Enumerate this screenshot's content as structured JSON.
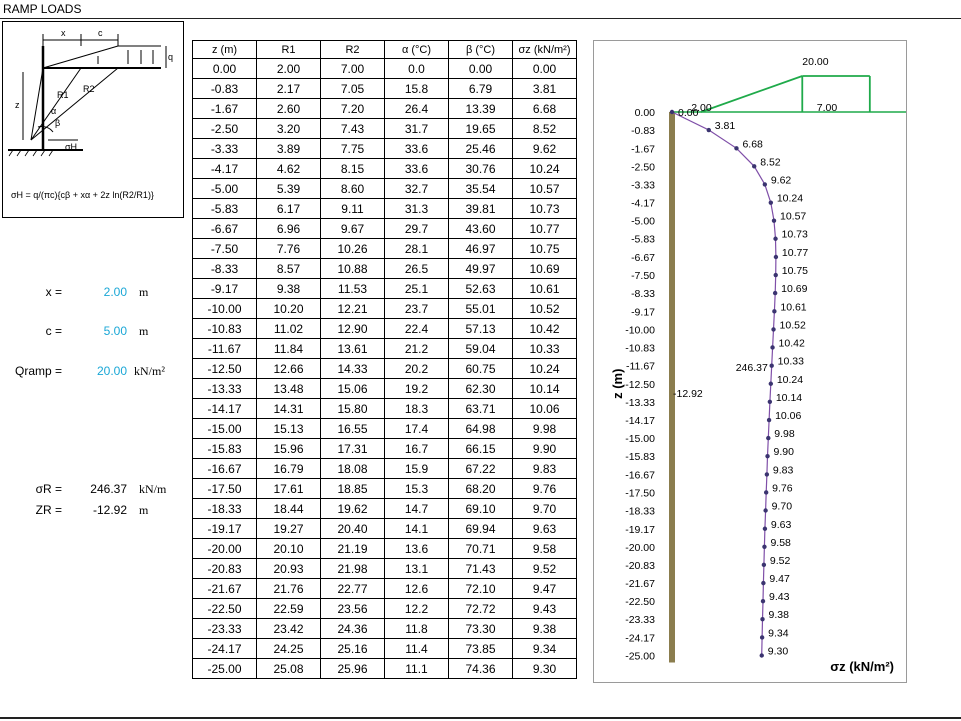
{
  "page": {
    "title": "RAMP LOADS"
  },
  "diagram": {
    "formula": "σH = q/(πc){cβ + xα + 2z ln(R2/R1)}"
  },
  "params": {
    "x": {
      "label": "x =",
      "value": "2.00",
      "unit": "m"
    },
    "c": {
      "label": "c =",
      "value": "5.00",
      "unit": "m"
    },
    "q": {
      "label": "Qramp =",
      "value": "20.00",
      "unit": "kN/m²"
    },
    "sr": {
      "label": "σR =",
      "value": "246.37",
      "unit": "kN/m"
    },
    "zr": {
      "label": "ZR =",
      "value": "-12.92",
      "unit": "m"
    }
  },
  "table": {
    "headers": [
      "z (m)",
      "R1",
      "R2",
      "α (°C)",
      "β (°C)",
      "σz (kN/m²)"
    ],
    "rows": [
      [
        "0.00",
        "2.00",
        "7.00",
        "0.0",
        "0.00",
        "0.00"
      ],
      [
        "-0.83",
        "2.17",
        "7.05",
        "15.8",
        "6.79",
        "3.81"
      ],
      [
        "-1.67",
        "2.60",
        "7.20",
        "26.4",
        "13.39",
        "6.68"
      ],
      [
        "-2.50",
        "3.20",
        "7.43",
        "31.7",
        "19.65",
        "8.52"
      ],
      [
        "-3.33",
        "3.89",
        "7.75",
        "33.6",
        "25.46",
        "9.62"
      ],
      [
        "-4.17",
        "4.62",
        "8.15",
        "33.6",
        "30.76",
        "10.24"
      ],
      [
        "-5.00",
        "5.39",
        "8.60",
        "32.7",
        "35.54",
        "10.57"
      ],
      [
        "-5.83",
        "6.17",
        "9.11",
        "31.3",
        "39.81",
        "10.73"
      ],
      [
        "-6.67",
        "6.96",
        "9.67",
        "29.7",
        "43.60",
        "10.77"
      ],
      [
        "-7.50",
        "7.76",
        "10.26",
        "28.1",
        "46.97",
        "10.75"
      ],
      [
        "-8.33",
        "8.57",
        "10.88",
        "26.5",
        "49.97",
        "10.69"
      ],
      [
        "-9.17",
        "9.38",
        "11.53",
        "25.1",
        "52.63",
        "10.61"
      ],
      [
        "-10.00",
        "10.20",
        "12.21",
        "23.7",
        "55.01",
        "10.52"
      ],
      [
        "-10.83",
        "11.02",
        "12.90",
        "22.4",
        "57.13",
        "10.42"
      ],
      [
        "-11.67",
        "11.84",
        "13.61",
        "21.2",
        "59.04",
        "10.33"
      ],
      [
        "-12.50",
        "12.66",
        "14.33",
        "20.2",
        "60.75",
        "10.24"
      ],
      [
        "-13.33",
        "13.48",
        "15.06",
        "19.2",
        "62.30",
        "10.14"
      ],
      [
        "-14.17",
        "14.31",
        "15.80",
        "18.3",
        "63.71",
        "10.06"
      ],
      [
        "-15.00",
        "15.13",
        "16.55",
        "17.4",
        "64.98",
        "9.98"
      ],
      [
        "-15.83",
        "15.96",
        "17.31",
        "16.7",
        "66.15",
        "9.90"
      ],
      [
        "-16.67",
        "16.79",
        "18.08",
        "15.9",
        "67.22",
        "9.83"
      ],
      [
        "-17.50",
        "17.61",
        "18.85",
        "15.3",
        "68.20",
        "9.76"
      ],
      [
        "-18.33",
        "18.44",
        "19.62",
        "14.7",
        "69.10",
        "9.70"
      ],
      [
        "-19.17",
        "19.27",
        "20.40",
        "14.1",
        "69.94",
        "9.63"
      ],
      [
        "-20.00",
        "20.10",
        "21.19",
        "13.6",
        "70.71",
        "9.58"
      ],
      [
        "-20.83",
        "20.93",
        "21.98",
        "13.1",
        "71.43",
        "9.52"
      ],
      [
        "-21.67",
        "21.76",
        "22.77",
        "12.6",
        "72.10",
        "9.47"
      ],
      [
        "-22.50",
        "22.59",
        "23.56",
        "12.2",
        "72.72",
        "9.43"
      ],
      [
        "-23.33",
        "23.42",
        "24.36",
        "11.8",
        "73.30",
        "9.38"
      ],
      [
        "-24.17",
        "24.25",
        "25.16",
        "11.4",
        "73.85",
        "9.34"
      ],
      [
        "-25.00",
        "25.08",
        "25.96",
        "11.1",
        "74.36",
        "9.30"
      ]
    ]
  },
  "chart_data": {
    "type": "line",
    "xlabel": "σz (kN/m²)",
    "ylabel": "z (m)",
    "ylim": [
      -25,
      0
    ],
    "z": [
      0,
      -0.83,
      -1.67,
      -2.5,
      -3.33,
      -4.17,
      -5,
      -5.83,
      -6.67,
      -7.5,
      -8.33,
      -9.17,
      -10,
      -10.83,
      -11.67,
      -12.5,
      -13.33,
      -14.17,
      -15,
      -15.83,
      -16.67,
      -17.5,
      -18.33,
      -19.17,
      -20,
      -20.83,
      -21.67,
      -22.5,
      -23.33,
      -24.17,
      -25
    ],
    "z_labels": [
      "0.00",
      "-0.83",
      "-1.67",
      "-2.50",
      "-3.33",
      "-4.17",
      "-5.00",
      "-5.83",
      "-6.67",
      "-7.50",
      "-8.33",
      "-9.17",
      "-10.00",
      "-10.83",
      "-11.67",
      "-12.50",
      "-13.33",
      "-14.17",
      "-15.00",
      "-15.83",
      "-16.67",
      "-17.50",
      "-18.33",
      "-19.17",
      "-20.00",
      "-20.83",
      "-21.67",
      "-22.50",
      "-23.33",
      "-24.17",
      "-25.00"
    ],
    "sigma": [
      0,
      3.81,
      6.68,
      8.52,
      9.62,
      10.24,
      10.57,
      10.73,
      10.77,
      10.75,
      10.69,
      10.61,
      10.52,
      10.42,
      10.33,
      10.24,
      10.14,
      10.06,
      9.98,
      9.9,
      9.83,
      9.76,
      9.7,
      9.63,
      9.58,
      9.52,
      9.47,
      9.43,
      9.38,
      9.34,
      9.3
    ],
    "sigma_labels": [
      "0.00",
      "3.81",
      "6.68",
      "8.52",
      "9.62",
      "10.24",
      "10.57",
      "10.73",
      "10.77",
      "10.75",
      "10.69",
      "10.61",
      "10.52",
      "10.42",
      "10.33",
      "10.24",
      "10.14",
      "10.06",
      "9.98",
      "9.90",
      "9.83",
      "9.76",
      "9.70",
      "9.63",
      "9.58",
      "9.52",
      "9.47",
      "9.43",
      "9.38",
      "9.34",
      "9.30"
    ],
    "load": {
      "q_label": "20.00",
      "x_label": "2.00",
      "xc_label": "7.00",
      "x": 2,
      "xc": 7,
      "q": 20
    },
    "resultant": {
      "value_label": "246.37",
      "z_label": "-12.92",
      "z": -12.92
    },
    "colors": {
      "curve": "#7f4fa8",
      "marker": "#3b3470",
      "load": "#1faa4a",
      "wall": "#8b7d4e"
    }
  }
}
